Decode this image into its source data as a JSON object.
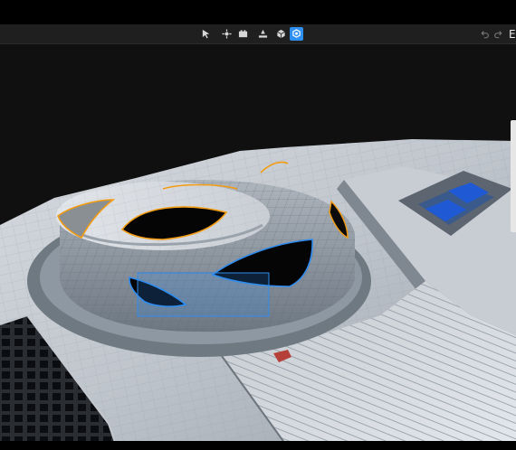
{
  "window": {
    "title": ""
  },
  "toolbar": {
    "tools": [
      {
        "name": "select-tool",
        "icon": "cursor-arrow-icon",
        "active": false
      },
      {
        "name": "transform-tool",
        "icon": "move-gizmo-icon",
        "active": false
      },
      {
        "name": "measure-tool",
        "icon": "ruler-card-icon",
        "active": false
      },
      {
        "name": "ground-tool",
        "icon": "ground-plane-icon",
        "active": false
      },
      {
        "name": "object-tool",
        "icon": "cube-icon",
        "active": false
      },
      {
        "name": "polygon-selection-tool",
        "icon": "polygon-select-icon",
        "active": true
      }
    ],
    "undo_icon": "undo-icon",
    "redo_icon": "redo-icon",
    "edge_label": "E"
  },
  "viewport": {
    "selection_color": "#2e8cf0",
    "hole_outline_color": "#f39c12",
    "active_tool_color": "#2d8ff0"
  }
}
